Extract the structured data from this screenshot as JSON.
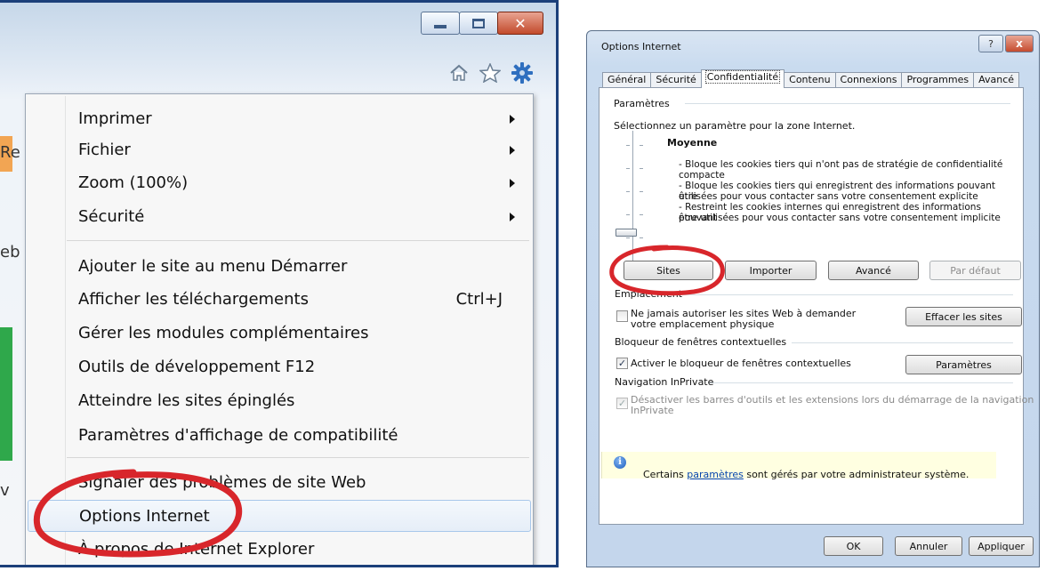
{
  "ie": {
    "menu_items": [
      {
        "label": "Imprimer",
        "submenu": true
      },
      {
        "label": "Fichier",
        "submenu": true
      },
      {
        "label": "Zoom (100%)",
        "submenu": true
      },
      {
        "label": "Sécurité",
        "submenu": true
      },
      {
        "label": "Ajouter le site au menu Démarrer"
      },
      {
        "label": "Afficher les téléchargements",
        "shortcut": "Ctrl+J"
      },
      {
        "label": "Gérer les modules complémentaires"
      },
      {
        "label": "Outils de développement F12"
      },
      {
        "label": "Atteindre les sites épinglés"
      },
      {
        "label": "Paramètres d'affichage de compatibilité"
      },
      {
        "label": "Signaler des problèmes de site Web"
      },
      {
        "label": "Options Internet"
      },
      {
        "label": "À propos de Internet Explorer"
      }
    ],
    "page_fragments": {
      "re": "Re",
      "eb": "eb",
      "v": "v"
    },
    "icons": [
      "home-icon",
      "favorites-star-icon",
      "tools-gear-icon"
    ]
  },
  "dialog": {
    "title": "Options Internet",
    "help_glyph": "?",
    "close_glyph": "x",
    "tabs": [
      "Général",
      "Sécurité",
      "Confidentialité",
      "Contenu",
      "Connexions",
      "Programmes",
      "Avancé"
    ],
    "active_tab": "Confidentialité",
    "settings": {
      "group_title": "Paramètres",
      "instruction": "Sélectionnez un paramètre pour la zone Internet.",
      "level": "Moyenne",
      "description": [
        "- Bloque les cookies tiers qui n'ont pas de stratégie de confidentialité",
        "compacte",
        "- Bloque les cookies tiers qui enregistrent des informations pouvant être",
        "utilisées pour vous contacter sans votre consentement explicite",
        "- Restreint les cookies internes qui enregistrent des informations pouvant",
        "être utilisées pour vous contacter sans votre consentement implicite"
      ],
      "buttons": {
        "sites": "Sites",
        "import": "Importer",
        "advanced": "Avancé",
        "default": "Par défaut"
      }
    },
    "location": {
      "group_title": "Emplacement",
      "checkbox_label_1": "Ne jamais autoriser les sites Web à demander",
      "checkbox_label_2": "votre emplacement physique",
      "checked": false,
      "clear_button": "Effacer les sites"
    },
    "popup": {
      "group_title": "Bloqueur de fenêtres contextuelles",
      "checkbox_label": "Activer le bloqueur de fenêtres contextuelles",
      "checked": true,
      "settings_button": "Paramètres"
    },
    "inprivate": {
      "group_title": "Navigation InPrivate",
      "checkbox_label_1": "Désactiver les barres d'outils et les extensions lors du démarrage de la navigation",
      "checkbox_label_2": "InPrivate",
      "checked": true
    },
    "info": {
      "text_before": "Certains ",
      "link": "paramètres",
      "text_after": " sont gérés par votre administrateur système."
    },
    "footer": {
      "ok": "OK",
      "cancel": "Annuler",
      "apply": "Appliquer"
    }
  },
  "colors": {
    "highlight_ellipse": "#d8262b"
  }
}
